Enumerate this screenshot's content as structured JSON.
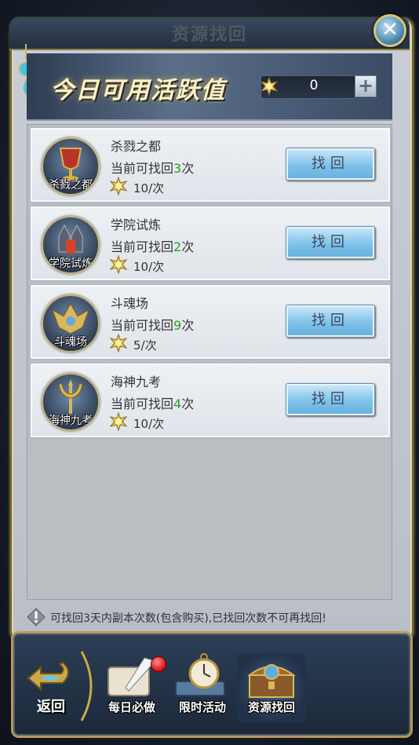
{
  "window": {
    "title": "资源找回",
    "close_icon": "close-icon"
  },
  "banner": {
    "title": "今日可用活跃值",
    "points_value": "0",
    "plus_label": "+"
  },
  "rows": [
    {
      "badge_label": "杀戮之都",
      "name": "杀戮之都",
      "count_prefix": "当前可找回",
      "count_value": "3",
      "count_suffix": "次",
      "cost": "10/次",
      "button_label": "找回"
    },
    {
      "badge_label": "学院试炼",
      "name": "学院试炼",
      "count_prefix": "当前可找回",
      "count_value": "2",
      "count_suffix": "次",
      "cost": "10/次",
      "button_label": "找回"
    },
    {
      "badge_label": "斗魂场",
      "name": "斗魂场",
      "count_prefix": "当前可找回",
      "count_value": "9",
      "count_suffix": "次",
      "cost": "5/次",
      "button_label": "找回"
    },
    {
      "badge_label": "海神九考",
      "name": "海神九考",
      "count_prefix": "当前可找回",
      "count_value": "4",
      "count_suffix": "次",
      "cost": "10/次",
      "button_label": "找回"
    }
  ],
  "note": {
    "text": "可找回3天内副本次数(包含购买),已找回次数不可再找回!"
  },
  "bottom_nav": {
    "back_label": "返回",
    "tabs": [
      {
        "label": "每日必做",
        "icon": "scroll-quill-icon",
        "has_notification": true
      },
      {
        "label": "限时活动",
        "icon": "pocket-watch-icon",
        "has_notification": false
      },
      {
        "label": "资源找回",
        "icon": "treasure-chest-icon",
        "has_notification": false,
        "active": true
      }
    ]
  },
  "colors": {
    "count_highlight": "#2f9a22",
    "button_blue": "#7fc2ea",
    "frame_gold": "#b49b55"
  }
}
